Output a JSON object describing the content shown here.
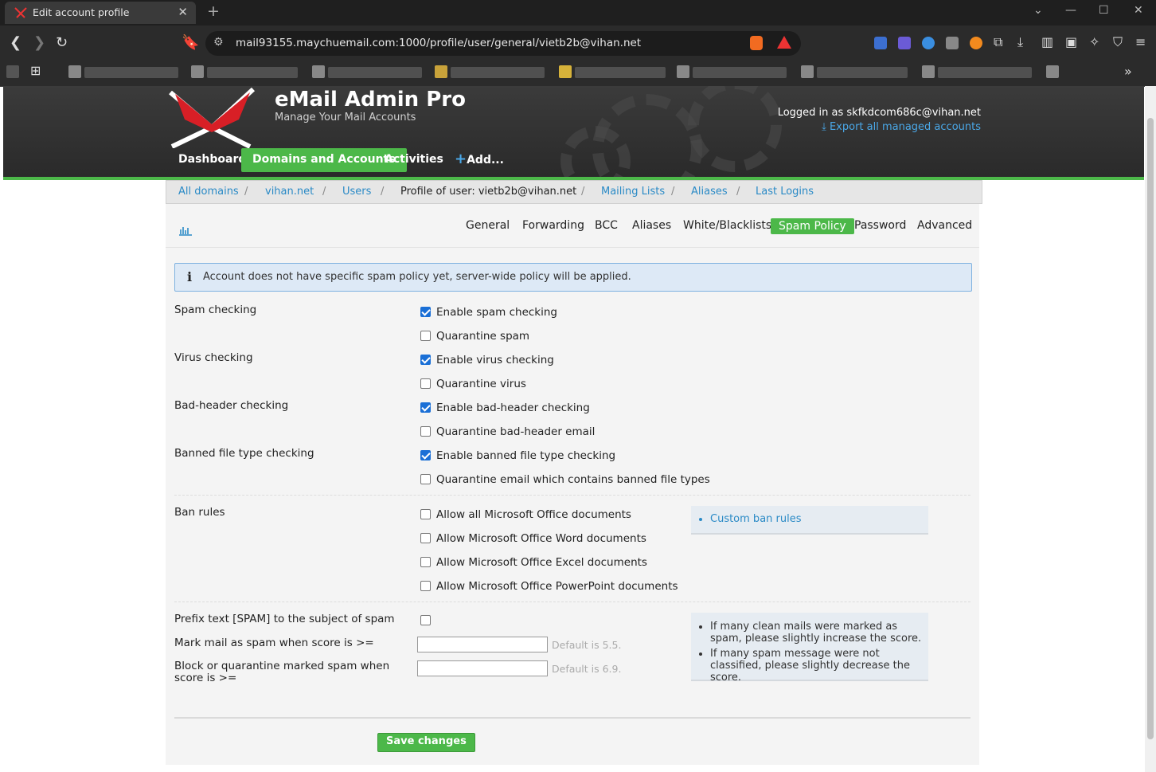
{
  "browser": {
    "tab_title": "Edit account profile",
    "url": "mail93155.maychuemail.com:1000/profile/user/general/vietb2b@vihan.net"
  },
  "app": {
    "brand": "eMail Admin Pro",
    "tagline": "Manage Your Mail Accounts",
    "logged_in": "Logged in as skfkdcom686c@vihan.net",
    "export": "Export all managed accounts",
    "nav": [
      "Dashboard",
      "Domains and Accounts",
      "Activities",
      "Add..."
    ]
  },
  "breadcrumb": {
    "all_domains": "All domains",
    "domain": "vihan.net",
    "users": "Users",
    "current": "Profile of user: vietb2b@vihan.net",
    "mailing_lists": "Mailing Lists",
    "aliases": "Aliases",
    "last_logins": "Last Logins"
  },
  "subnav": [
    "General",
    "Forwarding",
    "BCC",
    "Aliases",
    "White/Blacklists",
    "Spam Policy",
    "Password",
    "Advanced"
  ],
  "info": "Account does not have specific spam policy yet, server-wide policy will be applied.",
  "sections": {
    "spam_checking": "Spam checking",
    "virus_checking": "Virus checking",
    "bad_header_checking": "Bad-header checking",
    "banned_file_type_checking": "Banned file type checking",
    "ban_rules": "Ban rules",
    "prefix_text": "Prefix text [SPAM] to the subject of spam",
    "mark_spam": "Mark mail as spam when score is >=",
    "block_spam": "Block or quarantine marked spam when score is >="
  },
  "options": {
    "enable_spam": "Enable spam checking",
    "quarantine_spam": "Quarantine spam",
    "enable_virus": "Enable virus checking",
    "quarantine_virus": "Quarantine virus",
    "enable_bad_header": "Enable bad-header checking",
    "quarantine_bad_header": "Quarantine bad-header email",
    "enable_banned": "Enable banned file type checking",
    "quarantine_banned": "Quarantine email which contains banned file types",
    "allow_all_office": "Allow all Microsoft Office documents",
    "allow_word": "Allow Microsoft Office Word documents",
    "allow_excel": "Allow Microsoft Office Excel documents",
    "allow_ppt": "Allow Microsoft Office PowerPoint documents"
  },
  "hints": {
    "mark_default": "Default is 5.5.",
    "block_default": "Default is 6.9.",
    "custom_ban_rules": "Custom ban rules",
    "score_tip_1": "If many clean mails were marked as spam, please slightly increase the score.",
    "score_tip_2": "If many spam message were not classified, please slightly decrease the score."
  },
  "save_label": "Save changes"
}
